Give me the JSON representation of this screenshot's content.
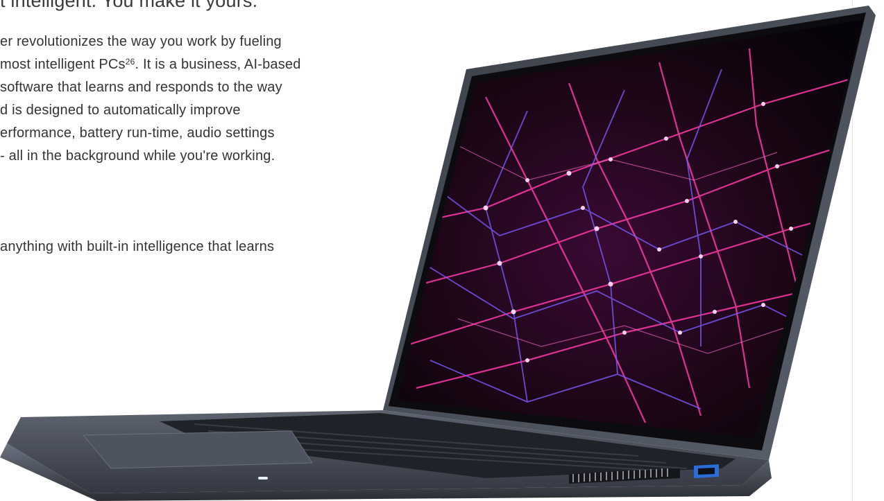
{
  "headline": "t intelligent. You make it yours.",
  "paragraph": {
    "line1": "er revolutionizes the way you work by fueling",
    "line2_a": "most intelligent PCs",
    "line2_sup": "26",
    "line2_b": ". It is a business, AI-based",
    "line3": " software that learns and responds to the way",
    "line4": "d is designed to automatically improve",
    "line5": "erformance, battery run-time, audio settings",
    "line6": "- all in the background while you're working."
  },
  "paragraph2": "anything with built-in intelligence that learns",
  "image": {
    "subject": "laptop",
    "screen_wallpaper": "abstract neon network mesh",
    "colors": {
      "body": "#4a505c",
      "keyboard": "#202329",
      "screen": "#1a0614",
      "mesh_pink": "#ff3aa8",
      "mesh_blue": "#7a5cff",
      "usb_port": "#2a6cd8"
    }
  }
}
